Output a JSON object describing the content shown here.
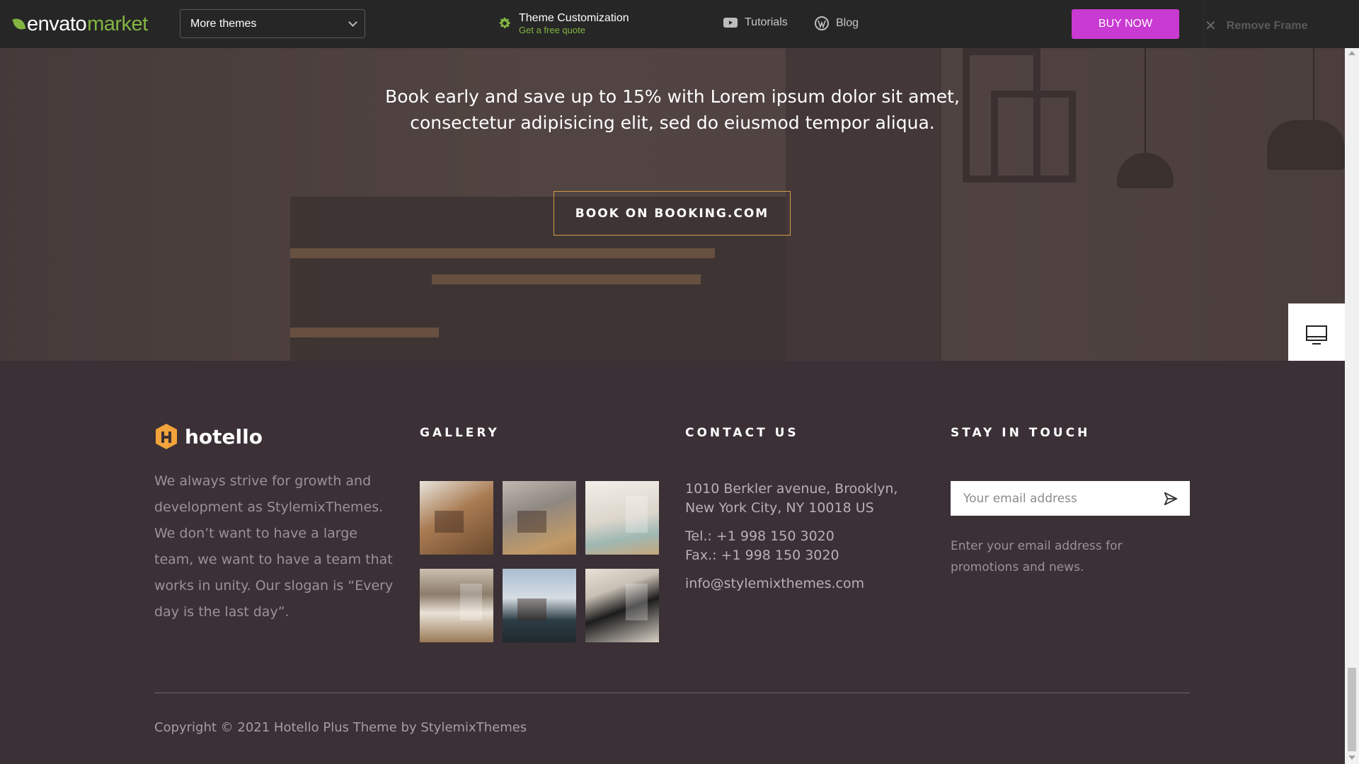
{
  "topbar": {
    "brand_main": "envato",
    "brand_sub": "market",
    "themes_select": "More themes",
    "customization_title": "Theme Customization",
    "customization_sub": "Get a free quote",
    "tutorials": "Tutorials",
    "blog": "Blog",
    "buy_now": "BUY NOW",
    "remove_frame": "Remove Frame",
    "colors": {
      "accent_green": "#82b541",
      "buy_button": "#c83ad1"
    }
  },
  "hero": {
    "text": "Book early and save up to 15% with Lorem ipsum dolor sit amet, consectetur adipisicing elit, sed do eiusmod tempor aliqua.",
    "button": "BOOK ON BOOKING.COM"
  },
  "side_widget": {
    "icons": [
      "monitor-icon",
      "support-lifebuoy-icon",
      "cart-icon"
    ]
  },
  "footer": {
    "logo": "hotello",
    "about": "We always strive for growth and development as StylemixThemes. We don’t want to have a large team, we want to have a team that works in unity. Our slogan is “Every day is the last day”.",
    "gallery_heading": "GALLERY",
    "gallery_images": [
      "dining-room-photo",
      "armchair-photo",
      "living-room-photo",
      "bedroom-photo",
      "window-view-photo",
      "portrait-art-photo"
    ],
    "contact_heading": "CONTACT US",
    "address_line1": "1010 Berkler avenue, Brooklyn,",
    "address_line2": "New York City, NY 10018 US",
    "tel": "Tel.: +1 998 150 3020",
    "fax": "Fax.: +1 998 150 3020",
    "email": "info@stylemixthemes.com",
    "stay_heading": "STAY IN TOUCH",
    "email_placeholder": "Your email address",
    "stay_note": "Enter your email address for promotions and news.",
    "copyright": "Copyright © 2021 Hotello Plus Theme by StylemixThemes"
  }
}
